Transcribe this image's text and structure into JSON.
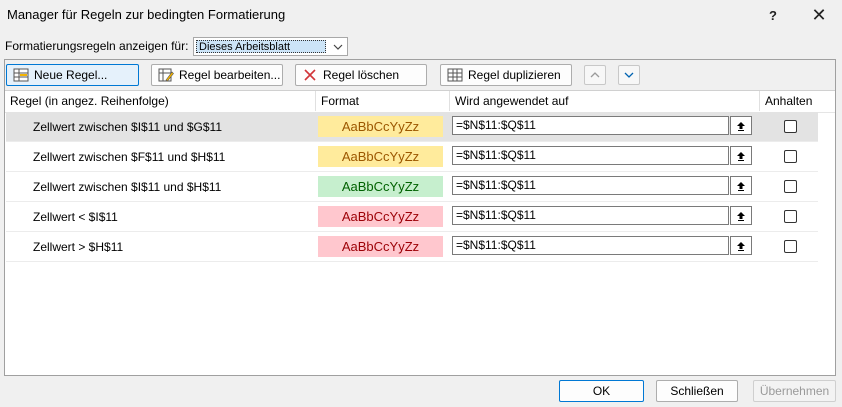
{
  "window": {
    "title": "Manager für Regeln zur bedingten Formatierung",
    "help": "?",
    "close": "✕"
  },
  "show_rules": {
    "label": "Formatierungsregeln anzeigen für:",
    "selected": "Dieses Arbeitsblatt"
  },
  "toolbar": {
    "new_rule": "Neue Regel...",
    "edit_rule": "Regel bearbeiten...",
    "delete_rule": "Regel löschen",
    "duplicate_rule": "Regel duplizieren"
  },
  "columns": {
    "rule": "Regel (in angez. Reihenfolge)",
    "format": "Format",
    "applies_to": "Wird angewendet auf",
    "stop": "Anhalten"
  },
  "rules": [
    {
      "rule": "Zellwert zwischen $I$11 und $G$11",
      "preview": "AaBbCcYyZz",
      "fill": "#ffeb9c",
      "font": "#9c5700",
      "applies_to": "=$N$11:$Q$11",
      "stop": false
    },
    {
      "rule": "Zellwert zwischen $F$11 und $H$11",
      "preview": "AaBbCcYyZz",
      "fill": "#ffeb9c",
      "font": "#9c5700",
      "applies_to": "=$N$11:$Q$11",
      "stop": false
    },
    {
      "rule": "Zellwert zwischen $I$11 und $H$11",
      "preview": "AaBbCcYyZz",
      "fill": "#c6efce",
      "font": "#006100",
      "applies_to": "=$N$11:$Q$11",
      "stop": false
    },
    {
      "rule": "Zellwert < $I$11",
      "preview": "AaBbCcYyZz",
      "fill": "#ffc7ce",
      "font": "#9c0006",
      "applies_to": "=$N$11:$Q$11",
      "stop": false
    },
    {
      "rule": "Zellwert > $H$11",
      "preview": "AaBbCcYyZz",
      "fill": "#ffc7ce",
      "font": "#9c0006",
      "applies_to": "=$N$11:$Q$11",
      "stop": false
    }
  ],
  "footer": {
    "ok": "OK",
    "close": "Schließen",
    "apply": "Übernehmen"
  }
}
